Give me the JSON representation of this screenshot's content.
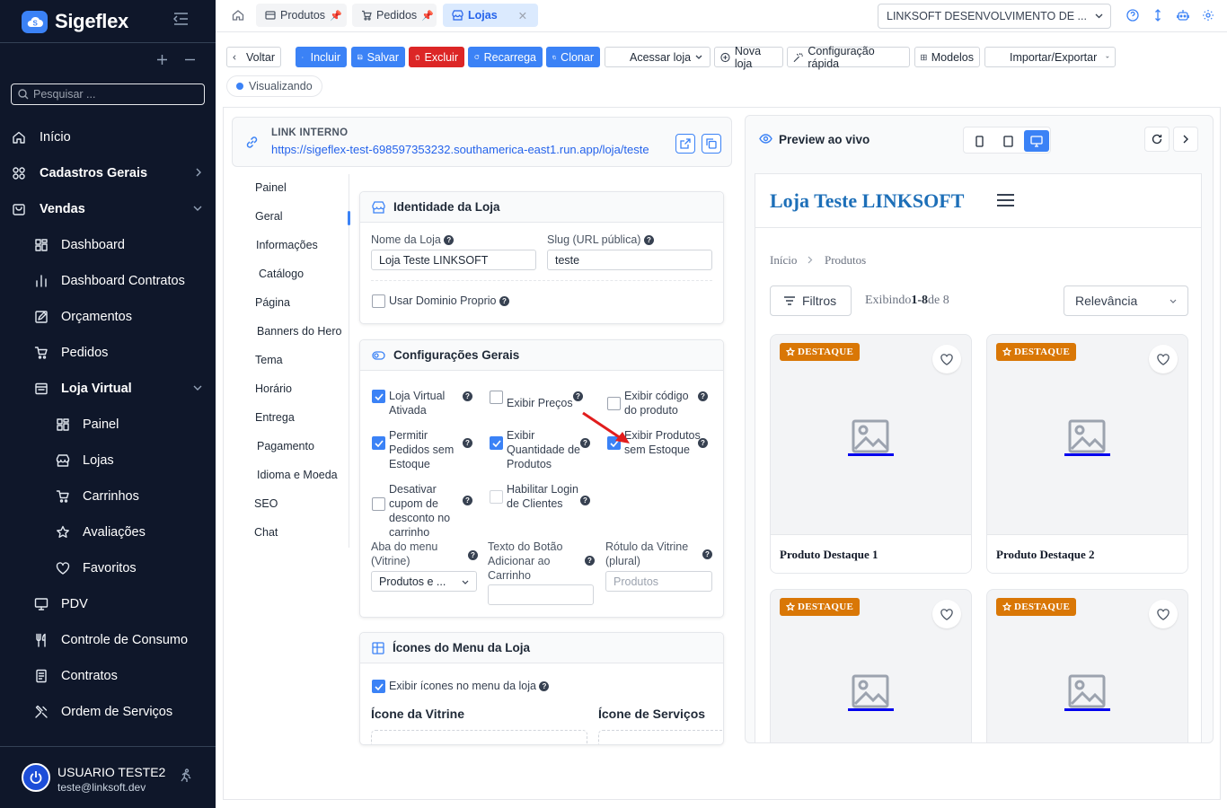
{
  "app": {
    "name": "Sigeflex"
  },
  "sidebar": {
    "search_placeholder": "Pesquisar ...",
    "items": [
      {
        "label": "Início",
        "icon": "home-icon",
        "level": 0
      },
      {
        "label": "Cadastros Gerais",
        "icon": "grid-icon",
        "level": 0,
        "bold": true,
        "chevron": "right"
      },
      {
        "label": "Vendas",
        "icon": "shopping-bag-icon",
        "level": 0,
        "bold": true,
        "chevron": "down"
      },
      {
        "label": "Dashboard",
        "icon": "dashboard-icon",
        "level": 1
      },
      {
        "label": "Dashboard Contratos",
        "icon": "bar-chart-icon",
        "level": 1
      },
      {
        "label": "Orçamentos",
        "icon": "edit-icon",
        "level": 1
      },
      {
        "label": "Pedidos",
        "icon": "cart-icon",
        "level": 1
      },
      {
        "label": "Loja Virtual",
        "icon": "store-icon",
        "level": 1,
        "bold": true,
        "chevron": "down"
      },
      {
        "label": "Painel",
        "icon": "dashboard-icon",
        "level": 2
      },
      {
        "label": "Lojas",
        "icon": "shop-icon",
        "level": 2
      },
      {
        "label": "Carrinhos",
        "icon": "cart-icon",
        "level": 2
      },
      {
        "label": "Avaliações",
        "icon": "star-icon",
        "level": 2
      },
      {
        "label": "Favoritos",
        "icon": "heart-icon",
        "level": 2
      },
      {
        "label": "PDV",
        "icon": "monitor-icon",
        "level": 1
      },
      {
        "label": "Controle de Consumo",
        "icon": "utensils-icon",
        "level": 1
      },
      {
        "label": "Contratos",
        "icon": "document-icon",
        "level": 1
      },
      {
        "label": "Ordem de Serviços",
        "icon": "tools-icon",
        "level": 1
      }
    ],
    "user": {
      "name": "USUARIO TESTE2",
      "email": "teste@linksoft.dev"
    }
  },
  "topbar": {
    "tabs": [
      {
        "label": "Produtos",
        "pinned": true
      },
      {
        "label": "Pedidos",
        "pinned": true
      },
      {
        "label": "Lojas",
        "active": true
      }
    ],
    "company": "LINKSOFT DESENVOLVIMENTO DE ..."
  },
  "toolbar": {
    "back": "Voltar",
    "include": "Incluir",
    "save": "Salvar",
    "delete": "Excluir",
    "reload": "Recarrega",
    "clone": "Clonar",
    "access_store": "Acessar loja",
    "new_store": "Nova loja",
    "quick_config": "Configuração rápida",
    "models": "Modelos",
    "import_export": "Importar/Exportar",
    "status": "Visualizando"
  },
  "link": {
    "label": "LINK INTERNO",
    "url": "https://sigeflex-test-698597353232.southamerica-east1.run.app/loja/teste"
  },
  "settings_nav": [
    "Painel",
    "Geral",
    "Informações",
    "Catálogo",
    "Página",
    "Banners do Hero",
    "Tema",
    "Horário",
    "Entrega",
    "Pagamento",
    "Idioma e Moeda",
    "SEO",
    "Chat"
  ],
  "settings_nav_active": "Geral",
  "identity": {
    "title": "Identidade da Loja",
    "name_label": "Nome da Loja",
    "name_value": "Loja Teste LINKSOFT",
    "slug_label": "Slug (URL pública)",
    "slug_value": "teste",
    "own_domain_label": "Usar Dominio Proprio",
    "own_domain_checked": false
  },
  "general": {
    "title": "Configurações Gerais",
    "options": [
      {
        "label": "Loja Virtual Ativada",
        "checked": true
      },
      {
        "label": "Exibir Preços",
        "checked": false
      },
      {
        "label": "Exibir código do produto",
        "checked": false
      },
      {
        "label": "Permitir Pedidos sem Estoque",
        "checked": true
      },
      {
        "label": "Exibir Quantidade de Produtos",
        "checked": true
      },
      {
        "label": "Exibir Produtos sem Estoque",
        "checked": true
      },
      {
        "label": "Desativar cupom de desconto no carrinho",
        "checked": false
      },
      {
        "label": "Habilitar Login de Clientes",
        "checked": false
      }
    ],
    "menu_tab_label": "Aba do menu (Vitrine)",
    "menu_tab_value": "Produtos e ...",
    "add_button_label": "Texto do Botão Adicionar ao Carrinho",
    "add_button_value": "",
    "showcase_label": "Rótulo da Vitrine (plural)",
    "showcase_placeholder": "Produtos"
  },
  "icons_section": {
    "title": "Ícones do Menu da Loja",
    "show_icons_label": "Exibir ícones no menu da loja",
    "show_icons_checked": true,
    "showcase_icon_label": "Ícone da Vitrine",
    "services_icon_label": "Ícone de Serviços"
  },
  "preview": {
    "title": "Preview ao vivo",
    "active_device": "desktop",
    "store_name": "Loja Teste LINKSOFT",
    "breadcrumb": [
      "Início",
      "Produtos"
    ],
    "filters": "Filtros",
    "showing_prefix": "Exibindo",
    "showing_range": "1-8",
    "showing_suffix": "de 8",
    "sort": "Relevância",
    "badge": "DESTAQUE",
    "products": [
      "Produto Destaque 1",
      "Produto Destaque 2",
      "",
      ""
    ]
  },
  "colors": {
    "accent": "#3b82f6",
    "sidebar_bg": "#0f172a",
    "danger": "#dc2626",
    "badge": "#d97706",
    "store_title": "#1d6fb8",
    "annotation_arrow": "#e11d1d"
  }
}
